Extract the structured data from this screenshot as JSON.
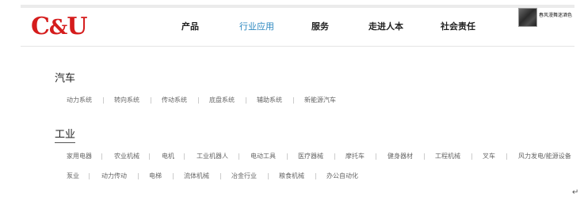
{
  "logo": {
    "c": "C",
    "amp": "&",
    "u": "U"
  },
  "nav": {
    "items": [
      {
        "label": "产品"
      },
      {
        "label": "行业应用"
      },
      {
        "label": "服务"
      },
      {
        "label": "走进人本"
      },
      {
        "label": "社会责任"
      }
    ],
    "active_index": 1,
    "active_color": "#2a86bf"
  },
  "thumbnail": {
    "caption": "春风漫舞迷酒色"
  },
  "categories": [
    {
      "title": "汽车",
      "items": [
        "动力系统",
        "转向系统",
        "传动系统",
        "底盘系统",
        "辅助系统",
        "新能源汽车"
      ]
    },
    {
      "title": "工业",
      "rows": [
        [
          "家用电器",
          "农业机械",
          "电机",
          "工业机器人",
          "电动工具",
          "医疗器械",
          "摩托车",
          "健身器材",
          "工程机械",
          "叉车",
          "风力发电/能源设备"
        ],
        [
          "泵业",
          "动力传动",
          "电梯",
          "流体机械",
          "冶金行业",
          "粮食机械",
          "办公自动化"
        ]
      ]
    }
  ],
  "brand_color": "#d51c1c",
  "return_glyph": "↵"
}
